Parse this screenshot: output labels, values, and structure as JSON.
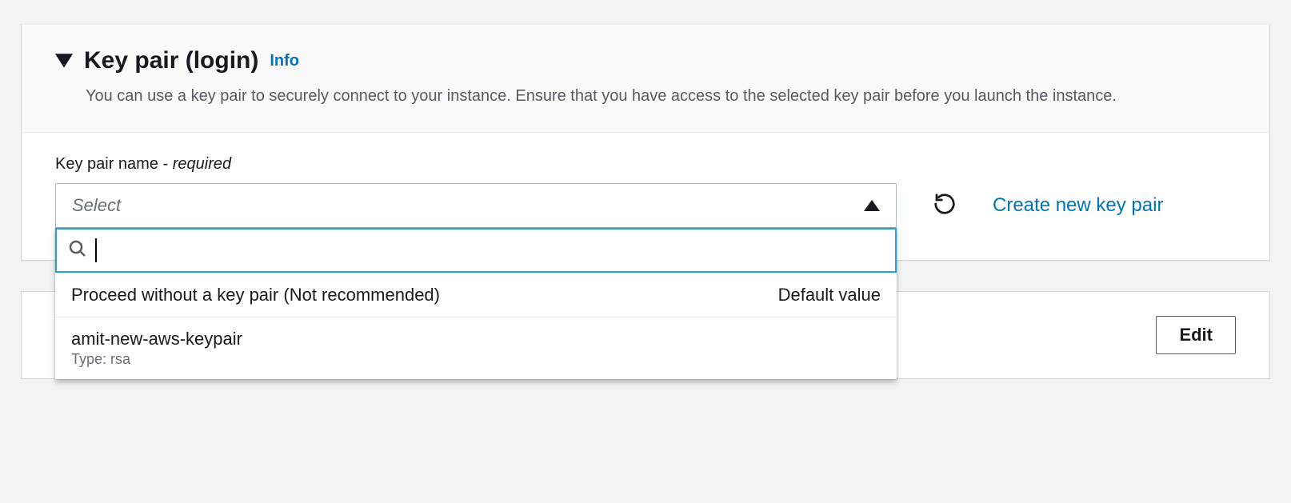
{
  "header": {
    "title": "Key pair (login)",
    "info_link": "Info",
    "description": "You can use a key pair to securely connect to your instance. Ensure that you have access to the selected key pair before you launch the instance."
  },
  "field": {
    "label": "Key pair name",
    "required_text": "required",
    "placeholder": "Select",
    "search_value": ""
  },
  "options": [
    {
      "label": "Proceed without a key pair (Not recommended)",
      "badge": "Default value",
      "sub": ""
    },
    {
      "label": "amit-new-aws-keypair",
      "badge": "",
      "sub": "Type: rsa"
    }
  ],
  "actions": {
    "create_link": "Create new key pair",
    "edit_button": "Edit"
  }
}
